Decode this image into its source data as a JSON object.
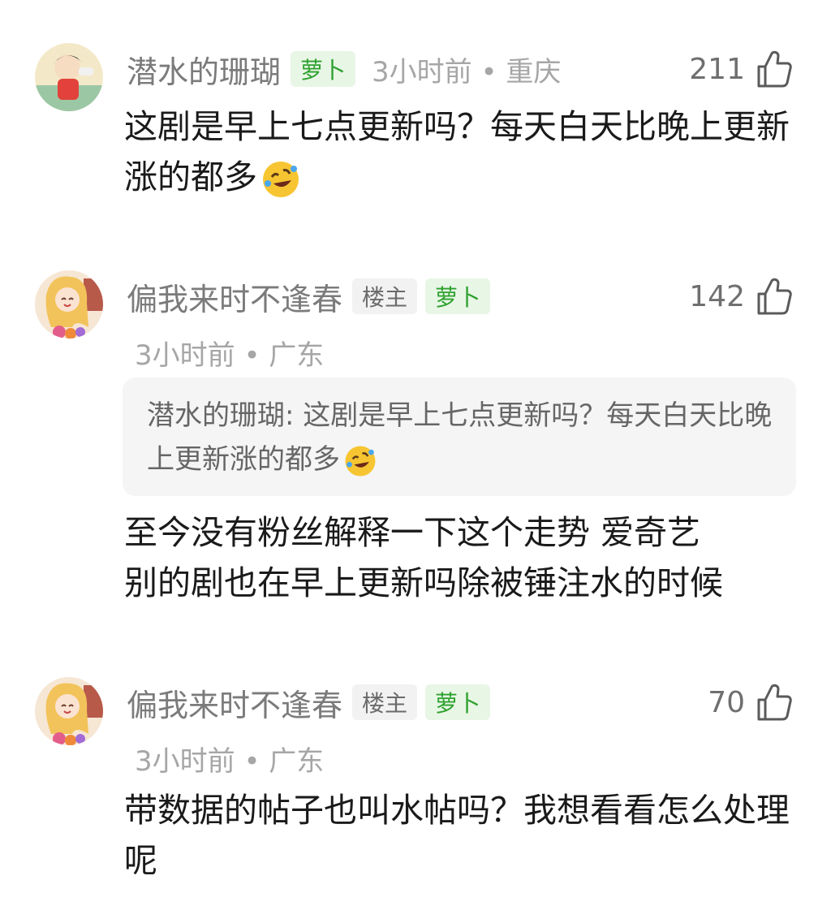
{
  "comments": [
    {
      "username": "潜水的珊瑚",
      "badge": "萝卜",
      "time_location": "3小时前 • 重庆",
      "likes": "211",
      "text": "这剧是早上七点更新吗？每天白天比晚上更新涨的都多",
      "emoji": "rolling-on-floor-laughing-emoji"
    },
    {
      "username": "偏我来时不逢春",
      "op_badge": "楼主",
      "badge": "萝卜",
      "time_location": "3小时前 • 广东",
      "likes": "142",
      "quote": {
        "author": "潜水的珊瑚:",
        "text": "这剧是早上七点更新吗？每天白天比晚上更新涨的都多",
        "emoji": "rolling-on-floor-laughing-emoji"
      },
      "text_line1": "至今没有粉丝解释一下这个走势 爱奇艺",
      "text_line2": "别的剧也在早上更新吗除被锤注水的时候"
    },
    {
      "username": "偏我来时不逢春",
      "op_badge": "楼主",
      "badge": "萝卜",
      "time_location": "3小时前 • 广东",
      "likes": "70",
      "text": "带数据的帖子也叫水帖吗？我想看看怎么处理呢"
    }
  ],
  "colors": {
    "username": "#7b7b7b",
    "meta": "#a6a6a6",
    "badge_green_bg": "#e8f6e6",
    "badge_green_text": "#2ea12e",
    "op_badge_bg": "#f2f2f2",
    "quote_bg": "#f5f5f5"
  }
}
